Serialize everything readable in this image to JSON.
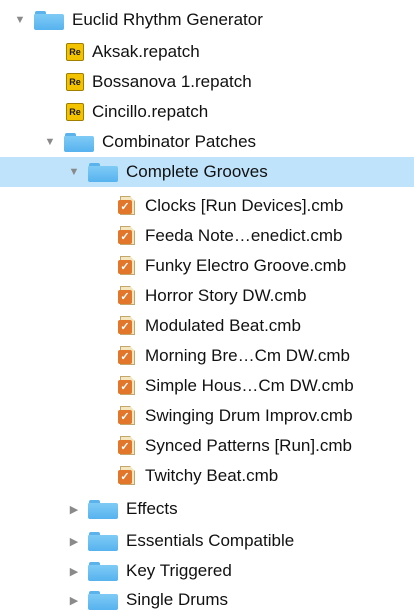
{
  "tree": {
    "root": {
      "label": "Euclid Rhythm Generator",
      "icon": "folder-icon",
      "expanded": true
    },
    "root_files": [
      {
        "label": "Aksak.repatch",
        "icon": "reason-patch-icon",
        "icon_text": "Re"
      },
      {
        "label": "Bossanova 1.repatch",
        "icon": "reason-patch-icon",
        "icon_text": "Re"
      },
      {
        "label": "Cincillo.repatch",
        "icon": "reason-patch-icon",
        "icon_text": "Re"
      }
    ],
    "combinator": {
      "label": "Combinator Patches",
      "icon": "folder-icon",
      "expanded": true
    },
    "complete": {
      "label": "Complete Grooves",
      "icon": "folder-icon",
      "expanded": true,
      "selected": true
    },
    "cmb_files": [
      {
        "label": "Clocks [Run Devices].cmb"
      },
      {
        "label": "Feeda Note…enedict.cmb"
      },
      {
        "label": "Funky Electro Groove.cmb"
      },
      {
        "label": "Horror Story DW.cmb"
      },
      {
        "label": "Modulated Beat.cmb"
      },
      {
        "label": "Morning Bre…Cm DW.cmb"
      },
      {
        "label": "Simple Hous…Cm DW.cmb"
      },
      {
        "label": "Swinging Drum Improv.cmb"
      },
      {
        "label": "Synced Patterns [Run].cmb"
      },
      {
        "label": "Twitchy Beat.cmb"
      }
    ],
    "cmb_icon": {
      "name": "combinator-patch-icon",
      "glyph": "✓"
    },
    "subfolders": [
      {
        "label": "Effects",
        "expanded": false
      },
      {
        "label": "Essentials Compatible",
        "expanded": false
      },
      {
        "label": "Key Triggered",
        "expanded": false
      },
      {
        "label": "Single Drums",
        "expanded": false
      }
    ],
    "glyphs": {
      "expanded": "▼",
      "collapsed": "▶"
    }
  },
  "colors": {
    "selection": "#bfe3fb",
    "folder": "#6cc0f3",
    "reason_patch": "#f3c300",
    "combinator_badge": "#e2762a"
  }
}
